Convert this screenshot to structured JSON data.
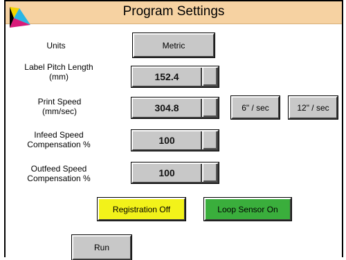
{
  "header": {
    "title": "Program Settings"
  },
  "fields": {
    "units": {
      "label": "Units",
      "value": "Metric"
    },
    "label_pitch": {
      "label_line1": "Label Pitch Length",
      "label_line2": "(mm)",
      "value": "152.4"
    },
    "print_speed": {
      "label_line1": "Print Speed",
      "label_line2": "(mm/sec)",
      "value": "304.8"
    },
    "infeed": {
      "label_line1": "Infeed Speed",
      "label_line2": "Compensation %",
      "value": "100"
    },
    "outfeed": {
      "label_line1": "Outfeed Speed",
      "label_line2": "Compensation %",
      "value": "100"
    }
  },
  "speed_presets": {
    "six": "6\" / sec",
    "twelve": "12\" / sec"
  },
  "toggles": {
    "registration": "Registration Off",
    "loop_sensor": "Loop Sensor On"
  },
  "actions": {
    "run": "Run"
  },
  "colors": {
    "title_bar": "#f6d2a2",
    "button_gray": "#c8c8c8",
    "registration_yellow": "#f2f21a",
    "loop_green": "#3aae3c",
    "logo_yellow": "#f2d400",
    "logo_cyan": "#29b6e6",
    "logo_magenta": "#d81b7a"
  }
}
